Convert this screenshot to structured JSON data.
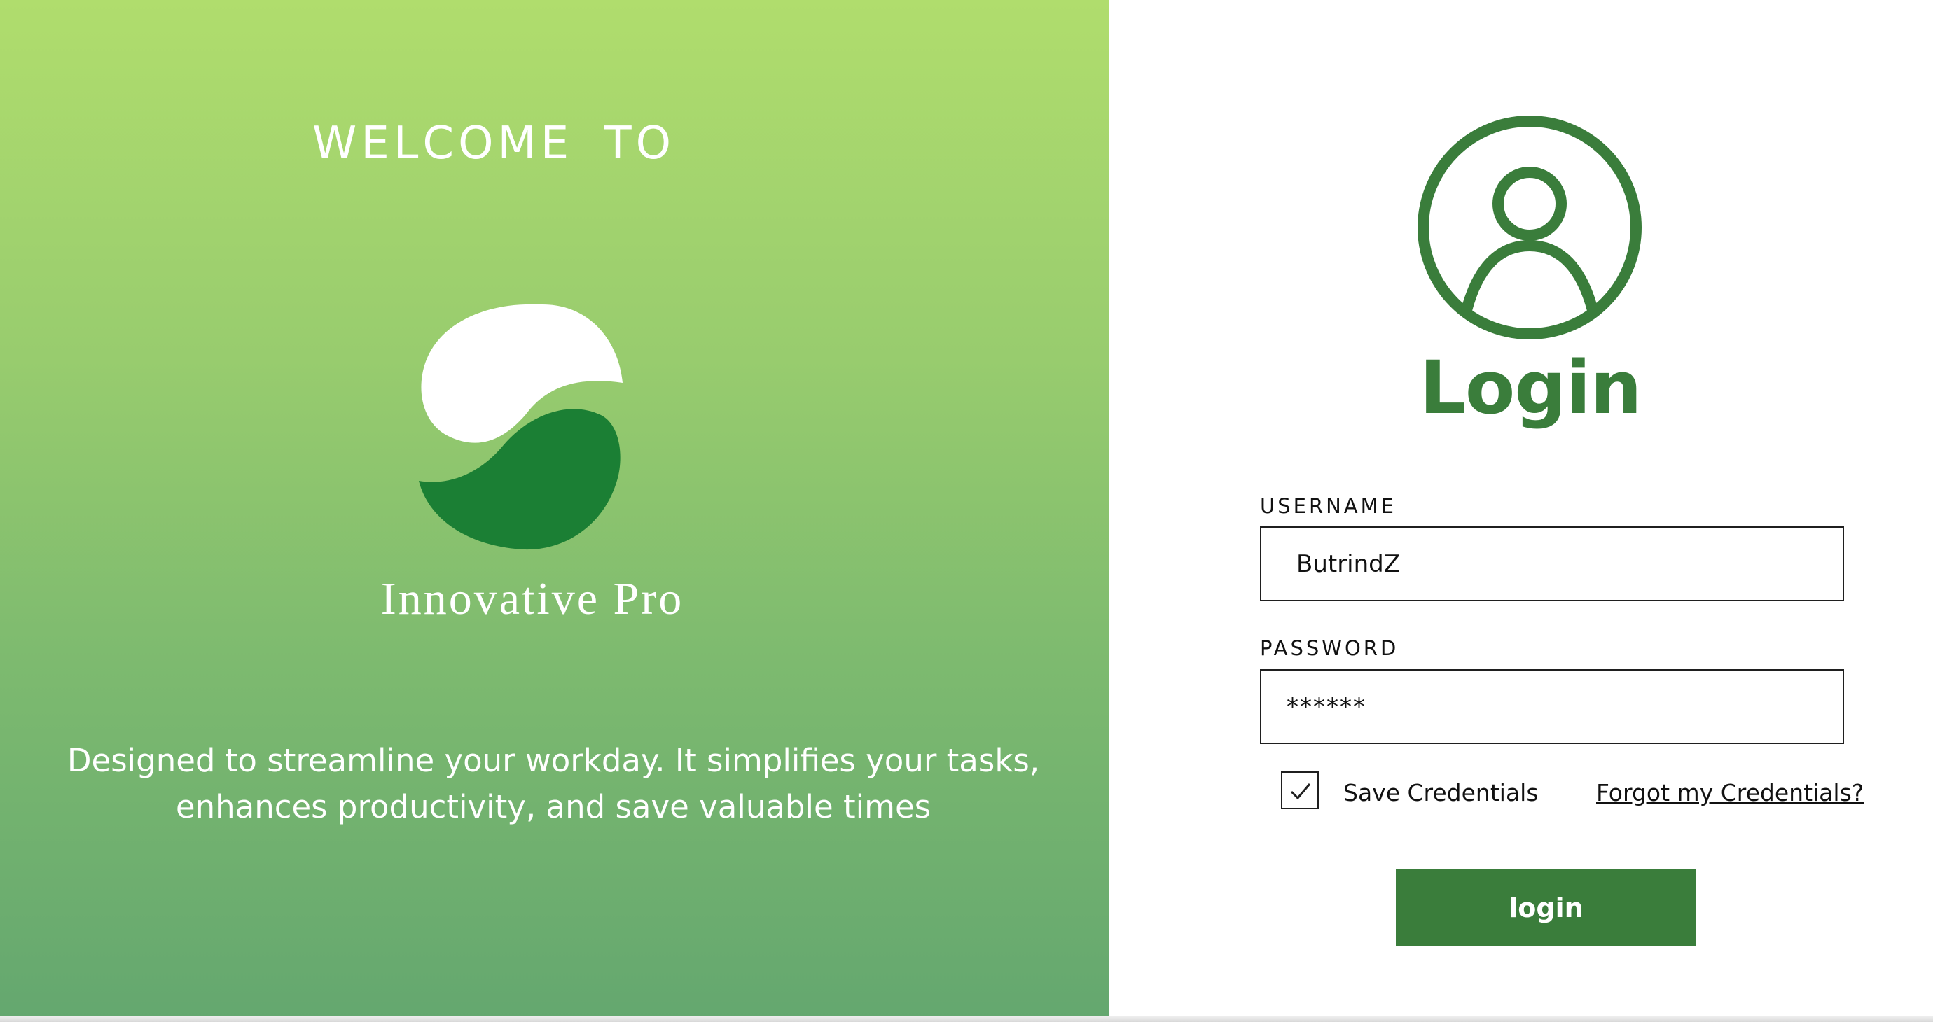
{
  "welcome": {
    "heading": "WELCOME TO",
    "brand_name": "Innovative Pro",
    "logo_icon": "innovative-pro-logo",
    "tagline_line1": "Designed to streamline your workday. It simplifies your tasks,",
    "tagline_line2": "enhances productivity, and save valuable times"
  },
  "login": {
    "avatar_icon": "user-circle-icon",
    "title": "Login",
    "username_label": "USERNAME",
    "username_value": "ButrindZ",
    "password_label": "PASSWORD",
    "password_value": "******",
    "save_credentials_label": "Save Credentials",
    "save_credentials_checked": true,
    "forgot_link": "Forgot my Credentials?",
    "submit_label": "login"
  },
  "colors": {
    "accent_green": "#3a7d3b",
    "logo_dark_green": "#1b7f34",
    "gradient_top": "#b0dd6d",
    "gradient_bottom": "#64a76f"
  }
}
